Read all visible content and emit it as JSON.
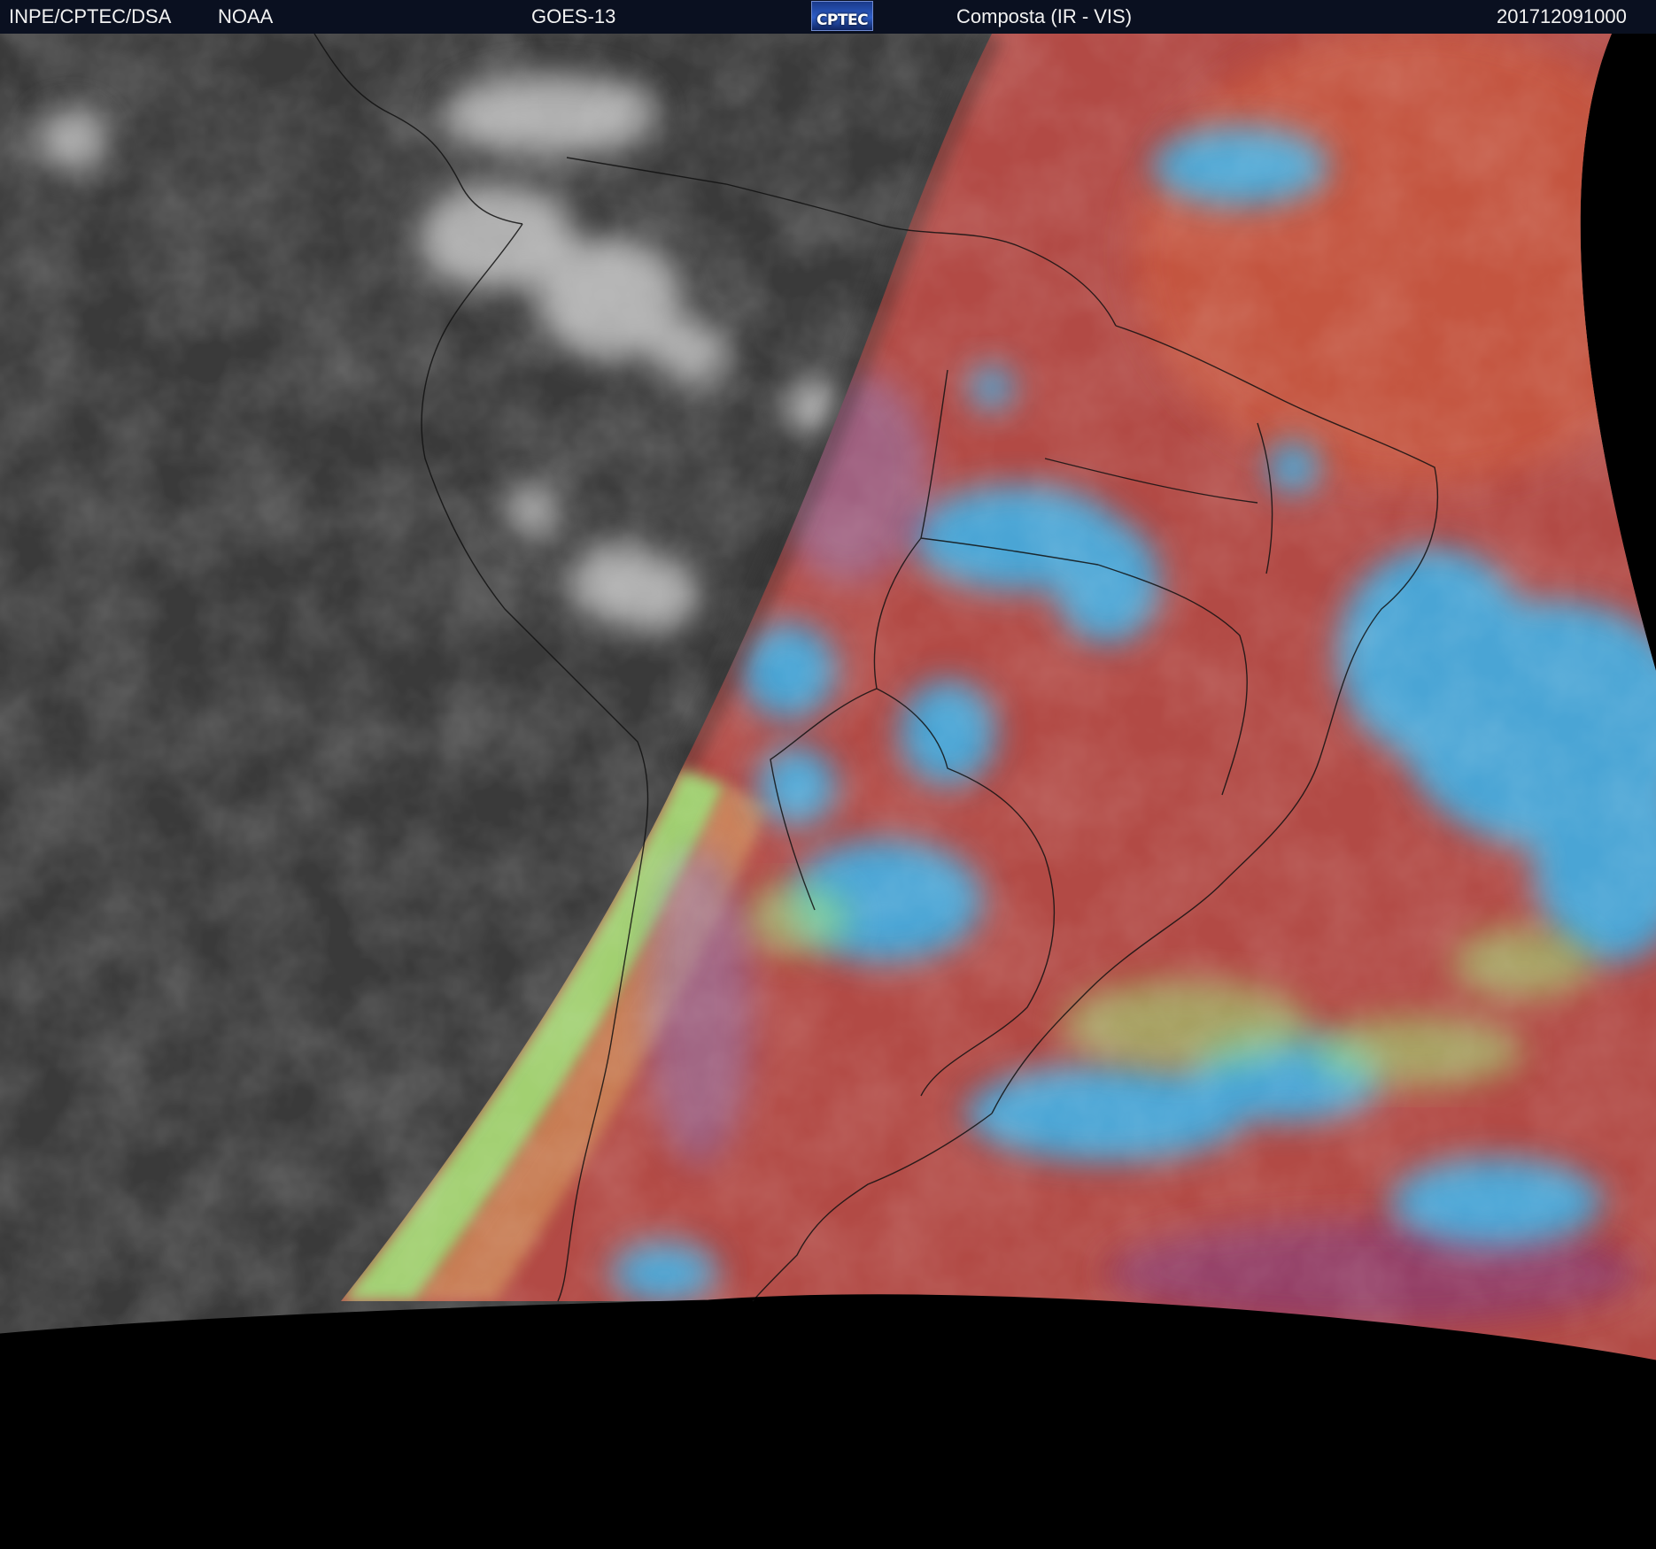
{
  "header": {
    "institution": "INPE/CPTEC/DSA",
    "agency": "NOAA",
    "satellite": "GOES-13",
    "logo_text": "CPTEC",
    "product": "Composta (IR - VIS)",
    "timestamp": "201712091000"
  },
  "image": {
    "content": "satellite-composite-south-america",
    "night_side_color": "#3a3a3a",
    "day_side_color": "#b24a45",
    "cloud_color_cold": "#38b6ef",
    "cloud_color_mid": "#9fe87a",
    "coastline_color": "#111111"
  }
}
